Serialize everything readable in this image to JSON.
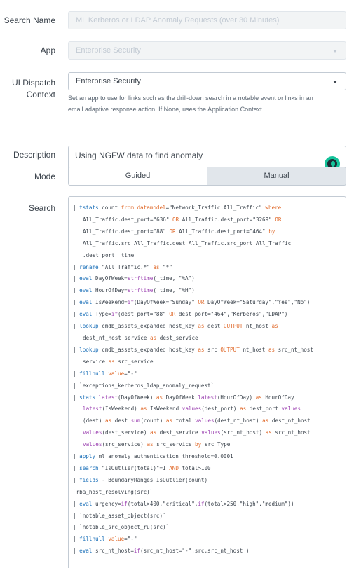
{
  "form": {
    "search_name": {
      "label": "Search Name",
      "value": "ML Kerberos or LDAP Anomaly Requests (over 30 Minutes)"
    },
    "app": {
      "label": "App",
      "value": "Enterprise Security"
    },
    "ui_dispatch": {
      "label_line1": "UI Dispatch",
      "label_line2": "Context",
      "value": "Enterprise Security",
      "help_line1": "Set an app to use for links such as the drill-down search in a notable event or links in an",
      "help_line2": "email adaptive response action. If None, uses the Application Context."
    },
    "description": {
      "label": "Description",
      "value": "Using NGFW data to find anomaly"
    },
    "mode": {
      "label": "Mode",
      "options": [
        "Guided",
        "Manual"
      ],
      "selected": "Manual"
    },
    "search": {
      "label": "Search"
    }
  },
  "spl_lines": [
    [
      {
        "t": "| ",
        "c": "pipe"
      },
      {
        "t": "tstats",
        "c": "cmd"
      },
      {
        "t": " count ",
        "c": "str"
      },
      {
        "t": "from",
        "c": "op"
      },
      {
        "t": " ",
        "c": "str"
      },
      {
        "t": "datamodel",
        "c": "op"
      },
      {
        "t": "=\"Network_Traffic.All_Traffic\" ",
        "c": "str"
      },
      {
        "t": "where",
        "c": "op"
      }
    ],
    [
      {
        "t": "All_Traffic.dest_port=\"636\" ",
        "c": "str",
        "cont": true
      },
      {
        "t": "OR",
        "c": "op"
      },
      {
        "t": " All_Traffic.dest_port=\"3269\" ",
        "c": "str"
      },
      {
        "t": "OR",
        "c": "op"
      }
    ],
    [
      {
        "t": "All_Traffic.dest_port=\"88\" ",
        "c": "str",
        "cont": true
      },
      {
        "t": "OR",
        "c": "op"
      },
      {
        "t": " All_Traffic.dest_port=\"464\" ",
        "c": "str"
      },
      {
        "t": "by",
        "c": "op"
      }
    ],
    [
      {
        "t": "All_Traffic.src All_Traffic.dest All_Traffic.src_port All_Traffic",
        "c": "str",
        "cont": true
      }
    ],
    [
      {
        "t": ".dest_port _time",
        "c": "str",
        "cont": true
      }
    ],
    [
      {
        "t": "| ",
        "c": "pipe"
      },
      {
        "t": "rename",
        "c": "cmd"
      },
      {
        "t": " \"All_Traffic.*\" ",
        "c": "str"
      },
      {
        "t": "as",
        "c": "op"
      },
      {
        "t": " \"*\"",
        "c": "str"
      }
    ],
    [
      {
        "t": "| ",
        "c": "pipe"
      },
      {
        "t": "eval",
        "c": "cmd"
      },
      {
        "t": " DayOfWeek=",
        "c": "str"
      },
      {
        "t": "strftime",
        "c": "fn"
      },
      {
        "t": "(_time, \"%A\")",
        "c": "str"
      }
    ],
    [
      {
        "t": "| ",
        "c": "pipe"
      },
      {
        "t": "eval",
        "c": "cmd"
      },
      {
        "t": " HourOfDay=",
        "c": "str"
      },
      {
        "t": "strftime",
        "c": "fn"
      },
      {
        "t": "(_time, \"%H\")",
        "c": "str"
      }
    ],
    [
      {
        "t": "| ",
        "c": "pipe"
      },
      {
        "t": "eval",
        "c": "cmd"
      },
      {
        "t": " IsWeekend=",
        "c": "str"
      },
      {
        "t": "if",
        "c": "fn"
      },
      {
        "t": "(DayOfWeek=\"Sunday\" ",
        "c": "str"
      },
      {
        "t": "OR",
        "c": "op"
      },
      {
        "t": " DayOfWeek=\"Saturday\",\"Yes\",\"No\")",
        "c": "str"
      }
    ],
    [
      {
        "t": "| ",
        "c": "pipe"
      },
      {
        "t": "eval",
        "c": "cmd"
      },
      {
        "t": " Type=",
        "c": "str"
      },
      {
        "t": "if",
        "c": "fn"
      },
      {
        "t": "(dest_port=\"88\" ",
        "c": "str"
      },
      {
        "t": "OR",
        "c": "op"
      },
      {
        "t": " dest_port=\"464\",\"Kerberos\",\"LDAP\")",
        "c": "str"
      }
    ],
    [
      {
        "t": "| ",
        "c": "pipe"
      },
      {
        "t": "lookup",
        "c": "cmd"
      },
      {
        "t": " cmdb_assets_expanded host_key ",
        "c": "str"
      },
      {
        "t": "as",
        "c": "op"
      },
      {
        "t": " dest ",
        "c": "str"
      },
      {
        "t": "OUTPUT",
        "c": "op"
      },
      {
        "t": " nt_host ",
        "c": "str"
      },
      {
        "t": "as",
        "c": "op"
      }
    ],
    [
      {
        "t": "dest_nt_host service ",
        "c": "str",
        "cont": true
      },
      {
        "t": "as",
        "c": "op"
      },
      {
        "t": " dest_service",
        "c": "str"
      }
    ],
    [
      {
        "t": "| ",
        "c": "pipe"
      },
      {
        "t": "lookup",
        "c": "cmd"
      },
      {
        "t": " cmdb_assets_expanded host_key ",
        "c": "str"
      },
      {
        "t": "as",
        "c": "op"
      },
      {
        "t": " src ",
        "c": "str"
      },
      {
        "t": "OUTPUT",
        "c": "op"
      },
      {
        "t": " nt_host ",
        "c": "str"
      },
      {
        "t": "as",
        "c": "op"
      },
      {
        "t": " src_nt_host",
        "c": "str"
      }
    ],
    [
      {
        "t": "service ",
        "c": "str",
        "cont": true
      },
      {
        "t": "as",
        "c": "op"
      },
      {
        "t": " src_service",
        "c": "str"
      }
    ],
    [
      {
        "t": "| ",
        "c": "pipe"
      },
      {
        "t": "fillnull",
        "c": "cmd"
      },
      {
        "t": " ",
        "c": "str"
      },
      {
        "t": "value",
        "c": "op"
      },
      {
        "t": "=\"-\"",
        "c": "str"
      }
    ],
    [
      {
        "t": "| `exceptions_kerberos_ldap_anomaly_request`",
        "c": "str"
      }
    ],
    [
      {
        "t": "| ",
        "c": "pipe"
      },
      {
        "t": "stats",
        "c": "cmd"
      },
      {
        "t": " ",
        "c": "str"
      },
      {
        "t": "latest",
        "c": "fn"
      },
      {
        "t": "(DayOfWeek) ",
        "c": "str"
      },
      {
        "t": "as",
        "c": "op"
      },
      {
        "t": " DayOfWeek ",
        "c": "str"
      },
      {
        "t": "latest",
        "c": "fn"
      },
      {
        "t": "(HourOfDay) ",
        "c": "str"
      },
      {
        "t": "as",
        "c": "op"
      },
      {
        "t": " HourOfDay",
        "c": "str"
      }
    ],
    [
      {
        "t": "latest",
        "c": "fn",
        "cont": true
      },
      {
        "t": "(IsWeekend) ",
        "c": "str"
      },
      {
        "t": "as",
        "c": "op"
      },
      {
        "t": " IsWeekend ",
        "c": "str"
      },
      {
        "t": "values",
        "c": "fn"
      },
      {
        "t": "(dest_port) ",
        "c": "str"
      },
      {
        "t": "as",
        "c": "op"
      },
      {
        "t": " dest_port ",
        "c": "str"
      },
      {
        "t": "values",
        "c": "fn"
      }
    ],
    [
      {
        "t": "(dest) ",
        "c": "str",
        "cont": true
      },
      {
        "t": "as",
        "c": "op"
      },
      {
        "t": " dest ",
        "c": "str"
      },
      {
        "t": "sum",
        "c": "fn"
      },
      {
        "t": "(count) ",
        "c": "str"
      },
      {
        "t": "as",
        "c": "op"
      },
      {
        "t": " total ",
        "c": "str"
      },
      {
        "t": "values",
        "c": "fn"
      },
      {
        "t": "(dest_nt_host) ",
        "c": "str"
      },
      {
        "t": "as",
        "c": "op"
      },
      {
        "t": " dest_nt_host",
        "c": "str"
      }
    ],
    [
      {
        "t": "values",
        "c": "fn",
        "cont": true
      },
      {
        "t": "(dest_service) ",
        "c": "str"
      },
      {
        "t": "as",
        "c": "op"
      },
      {
        "t": " dest_service ",
        "c": "str"
      },
      {
        "t": "values",
        "c": "fn"
      },
      {
        "t": "(src_nt_host) ",
        "c": "str"
      },
      {
        "t": "as",
        "c": "op"
      },
      {
        "t": " src_nt_host",
        "c": "str"
      }
    ],
    [
      {
        "t": "values",
        "c": "fn",
        "cont": true
      },
      {
        "t": "(src_service) ",
        "c": "str"
      },
      {
        "t": "as",
        "c": "op"
      },
      {
        "t": " src_service ",
        "c": "str"
      },
      {
        "t": "by",
        "c": "op"
      },
      {
        "t": " src Type",
        "c": "str"
      }
    ],
    [
      {
        "t": "| ",
        "c": "pipe"
      },
      {
        "t": "apply",
        "c": "cmd"
      },
      {
        "t": " ml_anomaly_authentication threshold=0.0001",
        "c": "str"
      }
    ],
    [
      {
        "t": "| ",
        "c": "pipe"
      },
      {
        "t": "search",
        "c": "cmd"
      },
      {
        "t": " \"IsOutlier(total)\"=1 ",
        "c": "str"
      },
      {
        "t": "AND",
        "c": "op"
      },
      {
        "t": " total>100",
        "c": "str"
      }
    ],
    [
      {
        "t": "| ",
        "c": "pipe"
      },
      {
        "t": "fields",
        "c": "cmd"
      },
      {
        "t": " - BoundaryRanges IsOutlier(count)",
        "c": "str"
      }
    ],
    [
      {
        "t": "`rba_host_resolving(src)`",
        "c": "str",
        "flush": true
      }
    ],
    [
      {
        "t": "| ",
        "c": "pipe"
      },
      {
        "t": "eval",
        "c": "cmd"
      },
      {
        "t": " urgency=",
        "c": "str"
      },
      {
        "t": "if",
        "c": "fn"
      },
      {
        "t": "(total>400,\"critical\",",
        "c": "str"
      },
      {
        "t": "if",
        "c": "fn"
      },
      {
        "t": "(total>250,\"high\",\"medium\"))",
        "c": "str"
      }
    ],
    [
      {
        "t": "| `notable_asset_object(src)`",
        "c": "str"
      }
    ],
    [
      {
        "t": "| `notable_src_object_ru(src)`",
        "c": "str"
      }
    ],
    [
      {
        "t": "| ",
        "c": "pipe"
      },
      {
        "t": "fillnull",
        "c": "cmd"
      },
      {
        "t": " ",
        "c": "str"
      },
      {
        "t": "value",
        "c": "op"
      },
      {
        "t": "=\"-\"",
        "c": "str"
      }
    ],
    [
      {
        "t": "| ",
        "c": "pipe"
      },
      {
        "t": "eval",
        "c": "cmd"
      },
      {
        "t": " src_nt_host=",
        "c": "str"
      },
      {
        "t": "if",
        "c": "fn"
      },
      {
        "t": "(src_nt_host=\"-\",src,src_nt_host )",
        "c": "str"
      }
    ]
  ]
}
